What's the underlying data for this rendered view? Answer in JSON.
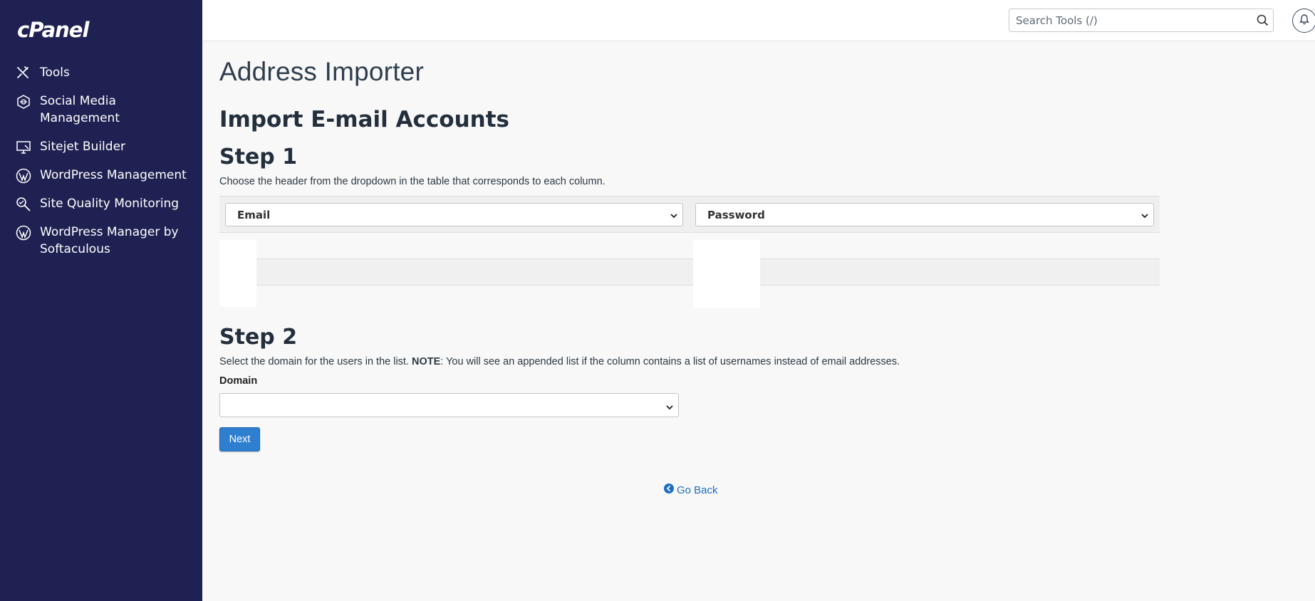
{
  "app": {
    "logo_text": "cPanel"
  },
  "sidebar": {
    "items": [
      {
        "label": "Tools",
        "icon": "tools-icon"
      },
      {
        "label": "Social Media\nManagement",
        "icon": "social-media-icon"
      },
      {
        "label": "Sitejet Builder",
        "icon": "sitejet-icon"
      },
      {
        "label": "WordPress Management",
        "icon": "wordpress-icon"
      },
      {
        "label": "Site Quality Monitoring",
        "icon": "site-quality-icon"
      },
      {
        "label": "WordPress Manager by\nSoftaculous",
        "icon": "wordpress-icon"
      }
    ]
  },
  "topbar": {
    "search_placeholder": "Search Tools (/)",
    "search_icon": "search-icon",
    "notification_icon": "bell-icon"
  },
  "main": {
    "page_title": "Address Importer",
    "section_title": "Import E-mail Accounts",
    "step1": {
      "heading": "Step 1",
      "help": "Choose the header from the dropdown in the table that corresponds to each column.",
      "columns": [
        {
          "selected": "Email"
        },
        {
          "selected": "Password"
        }
      ]
    },
    "step2": {
      "heading": "Step 2",
      "help_prefix": "Select the domain for the users in the list. ",
      "help_note": "NOTE",
      "help_suffix": ": You will see an appended list if the column contains a list of usernames instead of email addresses.",
      "domain_label": "Domain",
      "domain_selected": ""
    },
    "next_label": "Next",
    "go_back_label": "Go Back"
  },
  "colors": {
    "sidebar_bg": "#1f2152",
    "primary_button": "#2f7fd0",
    "link": "#1f6fc2"
  }
}
